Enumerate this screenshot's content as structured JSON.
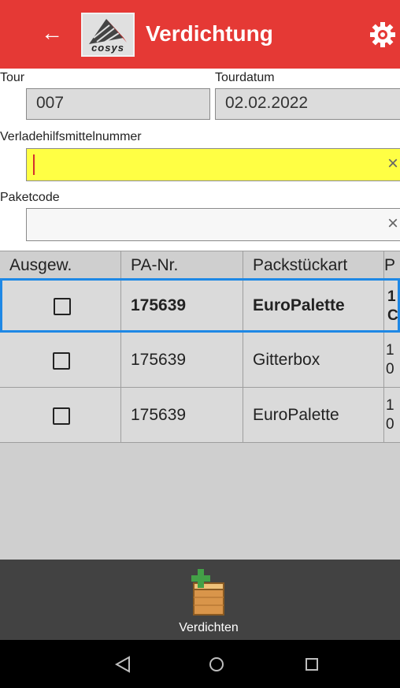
{
  "app": {
    "title": "Verdichtung",
    "logo_text": "cosys"
  },
  "form": {
    "tour_label": "Tour",
    "tour_value": "007",
    "tourdatum_label": "Tourdatum",
    "tourdatum_value": "02.02.2022",
    "verladehilfsmittel_label": "Verladehilfsmittelnummer",
    "verladehilfsmittel_value": "",
    "paketcode_label": "Paketcode",
    "paketcode_value": "",
    "clear_glyph": "×"
  },
  "table": {
    "columns": [
      "Ausgew.",
      "PA-Nr.",
      "Packstückart",
      "P"
    ],
    "rows": [
      {
        "selected": true,
        "checked": false,
        "pa_nr": "175639",
        "packstueckart": "EuroPalette",
        "extra_top": "1",
        "extra_bottom": "C"
      },
      {
        "selected": false,
        "checked": false,
        "pa_nr": "175639",
        "packstueckart": "Gitterbox",
        "extra_top": "1",
        "extra_bottom": "0"
      },
      {
        "selected": false,
        "checked": false,
        "pa_nr": "175639",
        "packstueckart": "EuroPalette",
        "extra_top": "1",
        "extra_bottom": "0"
      }
    ]
  },
  "bottom_action": {
    "label": "Verdichten",
    "icon": "crate-add-icon"
  },
  "colors": {
    "appbar": "#e53935",
    "active_input": "#ffff44",
    "selection": "#1e88e5",
    "bottombar": "#424242"
  }
}
